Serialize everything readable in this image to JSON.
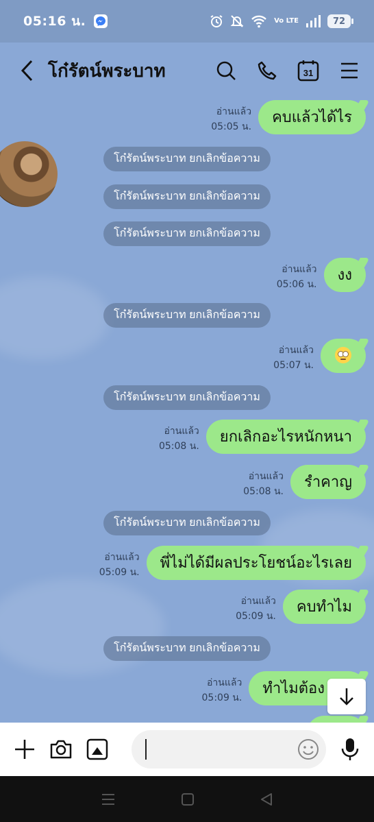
{
  "status_bar": {
    "time": "05:16 น.",
    "battery": "72",
    "network": "Vo LTE"
  },
  "header": {
    "title": "โก๋รัตน์พระบาท",
    "calendar_day": "31"
  },
  "messages": [
    {
      "kind": "out",
      "read": "อ่านแล้ว",
      "time": "05:05 น.",
      "text": "คบแล้วได้ไร"
    },
    {
      "kind": "sys",
      "text": "โก๋รัตน์พระบาท ยกเลิกข้อความ"
    },
    {
      "kind": "sys",
      "text": "โก๋รัตน์พระบาท ยกเลิกข้อความ"
    },
    {
      "kind": "sys",
      "text": "โก๋รัตน์พระบาท ยกเลิกข้อความ"
    },
    {
      "kind": "out",
      "read": "อ่านแล้ว",
      "time": "05:06 น.",
      "text": "งง"
    },
    {
      "kind": "sys",
      "text": "โก๋รัตน์พระบาท ยกเลิกข้อความ"
    },
    {
      "kind": "out",
      "read": "อ่านแล้ว",
      "time": "05:07 น.",
      "text": "",
      "emoji": "face-with-rolling-eyes"
    },
    {
      "kind": "sys",
      "text": "โก๋รัตน์พระบาท ยกเลิกข้อความ"
    },
    {
      "kind": "out",
      "read": "อ่านแล้ว",
      "time": "05:08 น.",
      "text": "ยกเลิกอะไรหนักหนา"
    },
    {
      "kind": "out",
      "read": "อ่านแล้ว",
      "time": "05:08 น.",
      "text": "รำคาญ"
    },
    {
      "kind": "sys",
      "text": "โก๋รัตน์พระบาท ยกเลิกข้อความ"
    },
    {
      "kind": "out",
      "read": "อ่านแล้ว",
      "time": "05:09 น.",
      "text": "พี่ไม่ได้มีผลประโยชน์อะไรเลย"
    },
    {
      "kind": "out",
      "read": "อ่านแล้ว",
      "time": "05:09 น.",
      "text": "คบทำไม"
    },
    {
      "kind": "sys",
      "text": "โก๋รัตน์พระบาท ยกเลิกข้อความ"
    },
    {
      "kind": "out",
      "read": "อ่านแล้ว",
      "time": "05:09 น.",
      "text": "ทำไมต้อง"
    }
  ],
  "input": {
    "placeholder": ""
  },
  "colors": {
    "chat_bg": "#8aa8d6",
    "bubble_out": "#9ce88a",
    "system_pill": "#5a6e8c"
  }
}
